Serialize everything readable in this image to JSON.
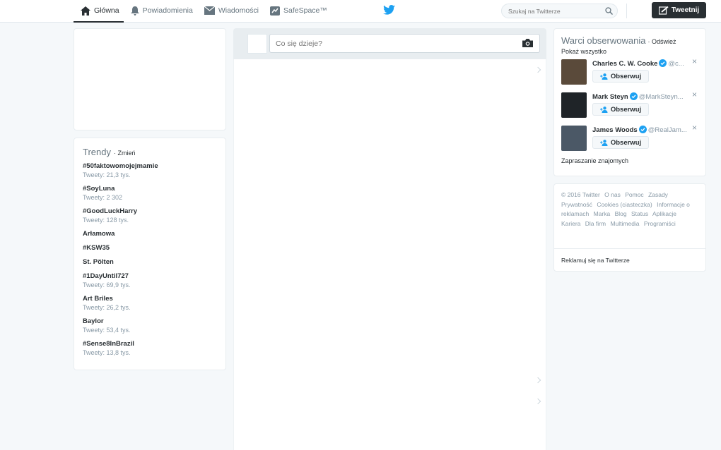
{
  "nav": {
    "items": [
      {
        "label": "Główna",
        "icon": "home-icon"
      },
      {
        "label": "Powiadomienia",
        "icon": "bell-icon"
      },
      {
        "label": "Wiadomości",
        "icon": "envelope-icon"
      },
      {
        "label": "SafeSpace™",
        "icon": "safespace-icon"
      }
    ],
    "search_placeholder": "Szukaj na Twitterze",
    "tweet_button": "Tweetnij"
  },
  "composer": {
    "placeholder": "Co się dzieje?"
  },
  "trends": {
    "title": "Trendy",
    "change": "· Zmień",
    "items": [
      {
        "name": "#50faktowomojejmamie",
        "count": "Tweety: 21,3 tys."
      },
      {
        "name": "#SoyLuna",
        "count": "Tweety: 2 302"
      },
      {
        "name": "#GoodLuckHarry",
        "count": "Tweety: 128 tys."
      },
      {
        "name": "Arłamowa",
        "count": ""
      },
      {
        "name": "#KSW35",
        "count": ""
      },
      {
        "name": "St. Pölten",
        "count": ""
      },
      {
        "name": "#1DayUntil727",
        "count": "Tweety: 69,9 tys."
      },
      {
        "name": "Art Briles",
        "count": "Tweety: 26,2 tys."
      },
      {
        "name": "Baylor",
        "count": "Tweety: 53,4 tys."
      },
      {
        "name": "#Sense8InBrazil",
        "count": "Tweety: 13,8 tys."
      }
    ]
  },
  "who_to_follow": {
    "title": "Warci obserwowania",
    "refresh": "· Odśwież",
    "show_all": "Pokaż wszystko",
    "follow_label": "Obserwuj",
    "users": [
      {
        "name": "Charles C. W. Cooke",
        "handle": "@c...",
        "avatar_color": "#5a4a3a"
      },
      {
        "name": "Mark Steyn",
        "handle": "@MarkSteyn...",
        "avatar_color": "#1f2428"
      },
      {
        "name": "James Woods",
        "handle": "@RealJam...",
        "avatar_color": "#4b5866"
      }
    ],
    "invite": "Zapraszanie znajomych"
  },
  "footer": {
    "links": [
      "© 2016 Twitter",
      "O nas",
      "Pomoc",
      "Zasady",
      "Prywatność",
      "Cookies (ciasteczka)",
      "Informacje o reklamach",
      "Marka",
      "Blog",
      "Status",
      "Aplikacje",
      "Kariera",
      "Dla firm",
      "Multimedia",
      "Programiści"
    ],
    "ads": "Reklamuj się na Twitterze"
  },
  "colors": {
    "twitter_blue": "#1da1f2",
    "dark": "#292f33",
    "muted": "#8899a6"
  }
}
